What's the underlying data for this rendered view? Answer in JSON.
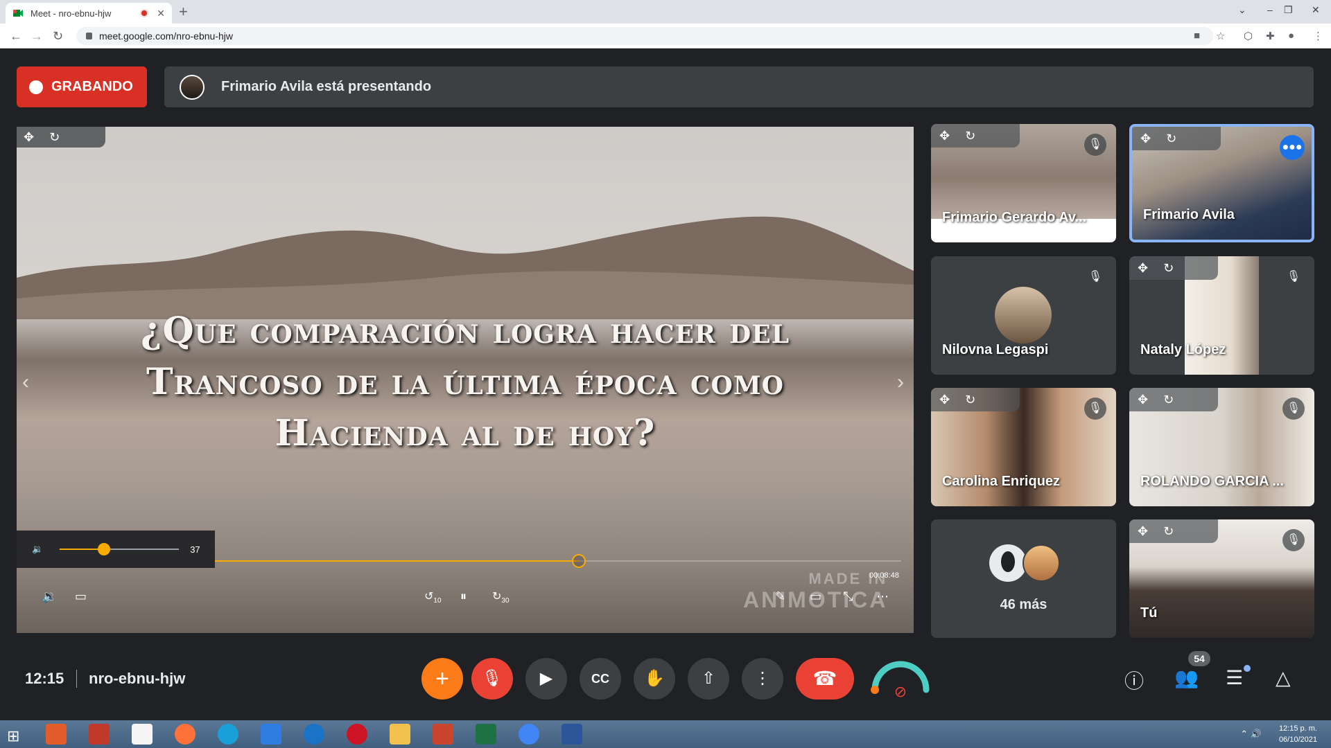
{
  "browser": {
    "tab_title": "Meet - nro-ebnu-hjw",
    "url": "meet.google.com/nro-ebnu-hjw"
  },
  "recording": {
    "label": "GRABANDO"
  },
  "presenting": {
    "text": "Frimario Avila está presentando"
  },
  "slide": {
    "lines": [
      "¿Que comparación logra hacer del",
      "Trancoso de la última época como",
      "Hacienda al de hoy?"
    ],
    "volume": 37,
    "volume_fraction": 0.37,
    "progress_fraction": 0.53,
    "time": "00:08:48",
    "rewind_label": "10",
    "forward_label": "30",
    "watermark_top": "MADE IN",
    "watermark_bottom": "ANIMOTICA"
  },
  "participants": [
    {
      "name": "Frimario Gerardo Av...",
      "muted": true,
      "kind": "screen"
    },
    {
      "name": "Frimario Avila",
      "muted": false,
      "speaking": true,
      "kind": "video"
    },
    {
      "name": "Nilovna Legaspi",
      "muted": true,
      "kind": "avatar"
    },
    {
      "name": "Nataly López",
      "muted": true,
      "kind": "video"
    },
    {
      "name": "Carolina Enriquez",
      "muted": true,
      "kind": "video"
    },
    {
      "name": "ROLANDO GARCIA ...",
      "muted": true,
      "kind": "video"
    },
    {
      "name": "Tú",
      "muted": true,
      "kind": "video"
    }
  ],
  "more": {
    "label": "46 más"
  },
  "bottom": {
    "time": "12:15",
    "meeting_code": "nro-ebnu-hjw",
    "participant_count": "54"
  },
  "taskbar": {
    "time": "12:15 p. m.",
    "date": "06/10/2021"
  },
  "colors": {
    "recording_red": "#d93025",
    "accent_orange": "#f9ab00",
    "active_blue": "#8ab4f8",
    "surface": "#3c4043",
    "background": "#202124"
  }
}
